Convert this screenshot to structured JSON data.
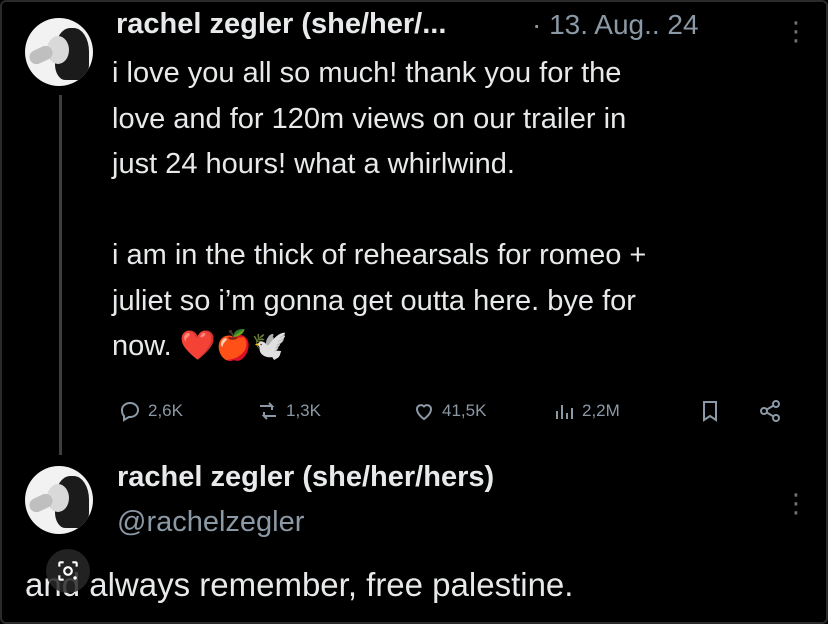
{
  "tweet1": {
    "author": "rachel zegler (she/her/...",
    "separator": "·",
    "date": "13. Aug.. 24",
    "more_menu": "⋮",
    "text": "i love you all so much! thank you for the\nlove and for 120m views on our trailer in\njust 24 hours! what a whirlwind.\n\ni am in the thick of rehearsals for romeo +\njuliet so i’m gonna get outta here. bye for\nnow. ❤️🍎🕊️",
    "actions": {
      "replies": "2,6K",
      "reposts": "1,3K",
      "likes": "41,5K",
      "views": "2,2M"
    },
    "icons": [
      "reply-icon",
      "repost-icon",
      "like-icon",
      "views-icon",
      "bookmark-icon",
      "share-icon"
    ]
  },
  "tweet2": {
    "author": "rachel zegler (she/her/hers)",
    "handle": "@rachelzegler",
    "more_menu": "⋮",
    "text": "and always remember, free palestine."
  },
  "overlay": {
    "icon": "image-search-icon"
  },
  "colors": {
    "background": "#000000",
    "text": "#e7e9ea",
    "muted": "#8b98a5",
    "thread_line": "#3b3f44"
  }
}
